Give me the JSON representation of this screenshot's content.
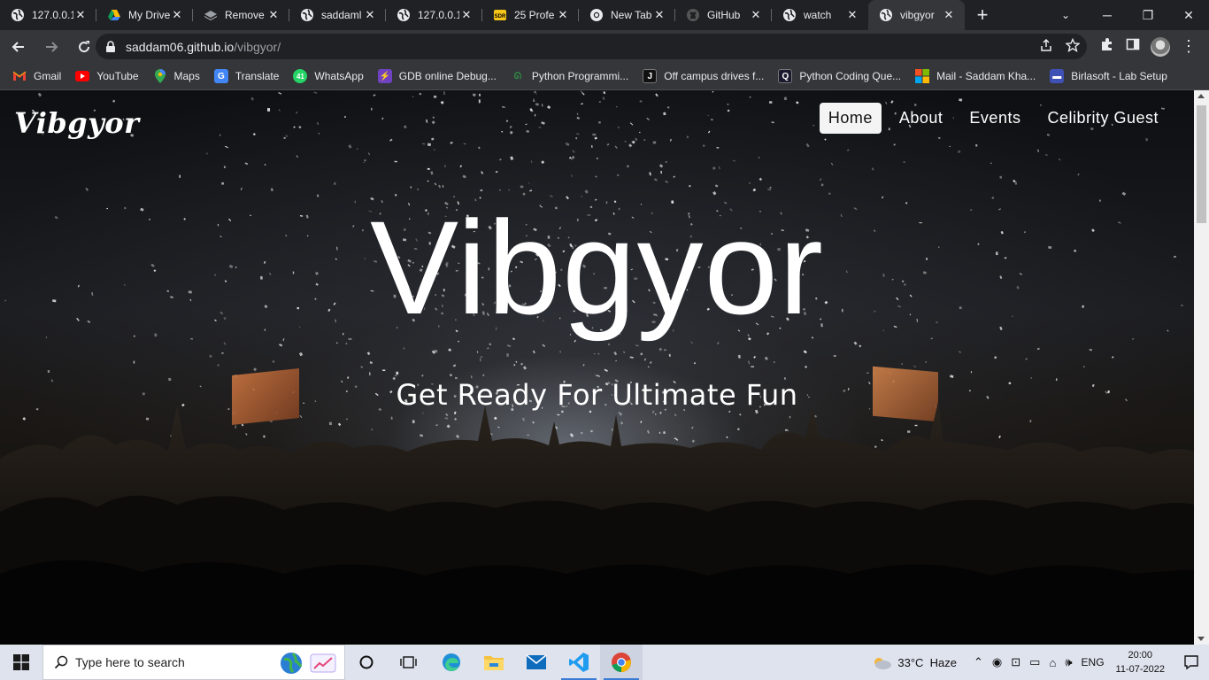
{
  "browser": {
    "tabs": [
      {
        "title": "127.0.0.1",
        "icon": "globe-icon"
      },
      {
        "title": "My Drive",
        "icon": "google-drive-icon"
      },
      {
        "title": "Remove",
        "icon": "layers-icon"
      },
      {
        "title": "saddaml",
        "icon": "globe-icon"
      },
      {
        "title": "127.0.0.1",
        "icon": "globe-icon"
      },
      {
        "title": "25 Profe",
        "icon": "sdr-icon"
      },
      {
        "title": "New Tab",
        "icon": "chrome-icon"
      },
      {
        "title": "GitHub",
        "icon": "github-icon"
      },
      {
        "title": "watch",
        "icon": "globe-icon"
      },
      {
        "title": "vibgyor",
        "icon": "globe-icon",
        "active": true
      }
    ],
    "url_host": "saddam06.github.io",
    "url_path": "/vibgyor/",
    "bookmarks": [
      {
        "label": "Gmail",
        "icon": "gmail-icon",
        "color": "#ea4335"
      },
      {
        "label": "YouTube",
        "icon": "youtube-icon",
        "color": "#ff0000"
      },
      {
        "label": "Maps",
        "icon": "maps-icon",
        "color": "#34a853"
      },
      {
        "label": "Translate",
        "icon": "translate-icon",
        "color": "#4285f4"
      },
      {
        "label": "WhatsApp",
        "icon": "whatsapp-icon",
        "color": "#25d366"
      },
      {
        "label": "GDB online Debug...",
        "icon": "gdb-icon",
        "color": "#6f42c1"
      },
      {
        "label": "Python Programmi...",
        "icon": "python-site-icon",
        "color": "#2f8d46"
      },
      {
        "label": "Off campus drives f...",
        "icon": "j-icon",
        "color": "#111111"
      },
      {
        "label": "Python Coding Que...",
        "icon": "q-icon",
        "color": "#1a1a2e"
      },
      {
        "label": "Mail - Saddam Kha...",
        "icon": "microsoft-icon",
        "color": "#f25022"
      },
      {
        "label": "Birlasoft - Lab Setup",
        "icon": "birlasoft-icon",
        "color": "#3f51b5"
      }
    ]
  },
  "site": {
    "logo": "Vibgyor",
    "nav": [
      {
        "label": "Home",
        "active": true
      },
      {
        "label": "About"
      },
      {
        "label": "Events"
      },
      {
        "label": "Celibrity Guest"
      }
    ],
    "hero_title": "Vibgyor",
    "hero_subtitle": "Get Ready For Ultimate Fun"
  },
  "taskbar": {
    "search_placeholder": "Type here to search",
    "apps": [
      "task-view-icon",
      "edge-icon",
      "file-explorer-icon",
      "mail-icon",
      "vscode-icon",
      "chrome-icon"
    ],
    "weather": "33°C  Haze",
    "language": "ENG",
    "time": "20:00",
    "date": "11-07-2022"
  }
}
